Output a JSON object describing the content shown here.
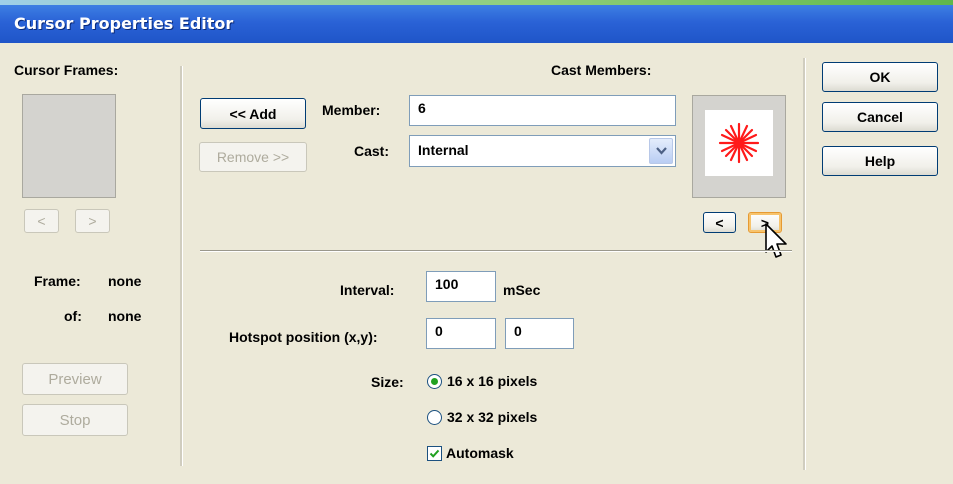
{
  "window": {
    "title": "Cursor Properties Editor"
  },
  "cursor_frames": {
    "heading": "Cursor Frames:",
    "prev_label": "<",
    "next_label": ">",
    "frame_label": "Frame:",
    "frame_value": "none",
    "of_label": "of:",
    "of_value": "none",
    "preview_label": "Preview",
    "stop_label": "Stop"
  },
  "cast_members": {
    "heading": "Cast Members:",
    "add_label": "<< Add",
    "remove_label": "Remove >>",
    "member_label": "Member:",
    "member_value": "6",
    "cast_label": "Cast:",
    "cast_value": "Internal",
    "prev_label": "<",
    "next_label": ">"
  },
  "options": {
    "interval_label": "Interval:",
    "interval_value": "100",
    "interval_unit": "mSec",
    "hotspot_label": "Hotspot position (x,y):",
    "hotspot_x": "0",
    "hotspot_y": "0",
    "size_label": "Size:",
    "size_16": "16 x 16 pixels",
    "size_32": "32 x 32 pixels",
    "size_selected": "16 x 16 pixels",
    "automask_label": "Automask",
    "automask_checked": true
  },
  "actions": {
    "ok_label": "OK",
    "cancel_label": "Cancel",
    "help_label": "Help"
  },
  "colors": {
    "titlebar": "#2a62d6",
    "dialog_bg": "#ece9d8",
    "cursor_star": "#ff1a1a",
    "radio_dot": "#21a121"
  }
}
